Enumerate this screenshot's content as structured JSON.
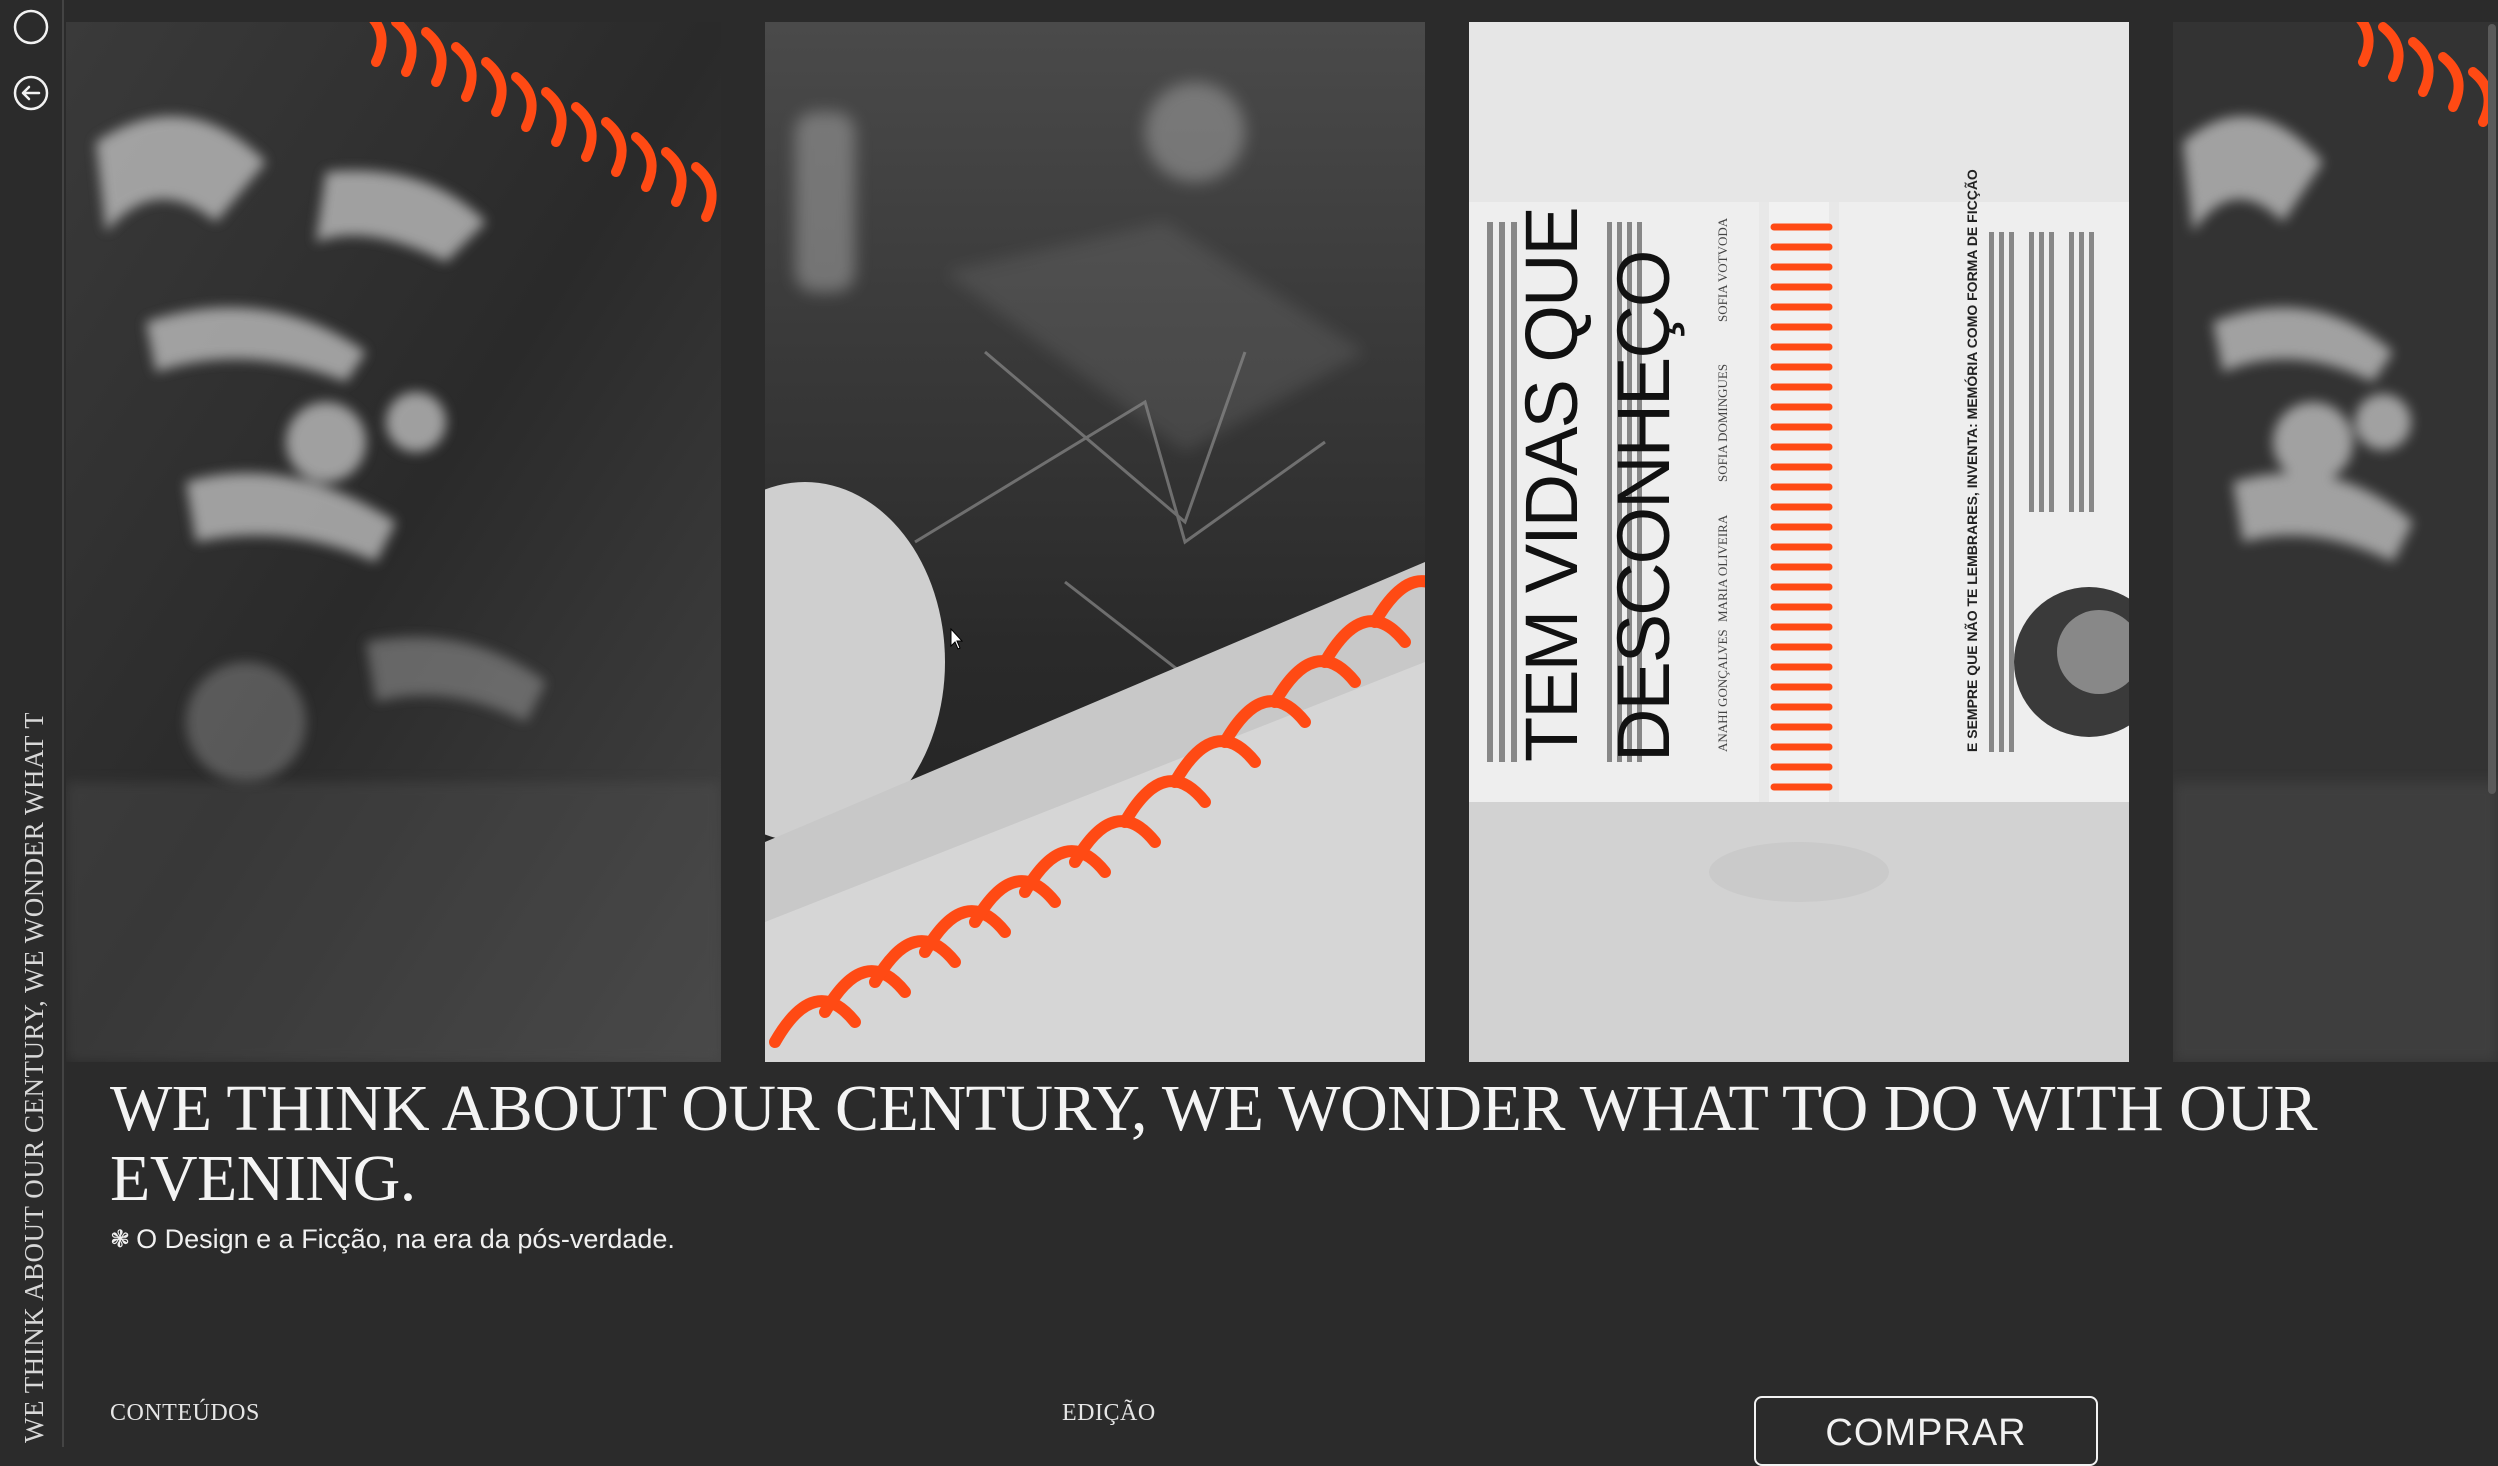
{
  "sidebar": {
    "icons": [
      "circle-icon",
      "back-arrow-icon"
    ],
    "ticker_text": "WE THINK ABOUT OUR CENTURY, WE WONDER WHAT TO DO WITH OUR"
  },
  "gallery": {
    "panels": [
      {
        "name": "spiral-notebook-closeup-left"
      },
      {
        "name": "orange-spiral-binding-closeup"
      },
      {
        "name": "open-book-spread"
      },
      {
        "name": "spiral-notebook-closeup-right"
      }
    ],
    "book_spread": {
      "big_title_line1": "TEM VIDAS QUE",
      "big_title_line2": "DESCONHEÇO",
      "authors": [
        "SOFIA VOTVODA",
        "SOFIA DOMINGUES",
        "MARIA OLIVEIRA",
        "ANAHI GONÇALVES"
      ],
      "right_heading": "E SEMPRE QUE NÃO TE LEMBRARES, INVENTA: MEMÓRIA COMO FORMA DE FICÇÃO"
    }
  },
  "hero": {
    "headline": "WE THINK ABOUT OUR CENTURY, WE WONDER WHAT TO DO WITH OUR EVENING.",
    "subtitle_icon": "❃",
    "subtitle": "O Design e a Ficção, na era da pós-verdade."
  },
  "footer_nav": {
    "contents_label": "CONTEÚDOS",
    "edition_label": "EDIÇÃO",
    "buy_label": "COMPRAR"
  },
  "colors": {
    "background": "#2b2b2b",
    "accent_orange": "#ff4a14",
    "text": "#f2f2f2"
  }
}
